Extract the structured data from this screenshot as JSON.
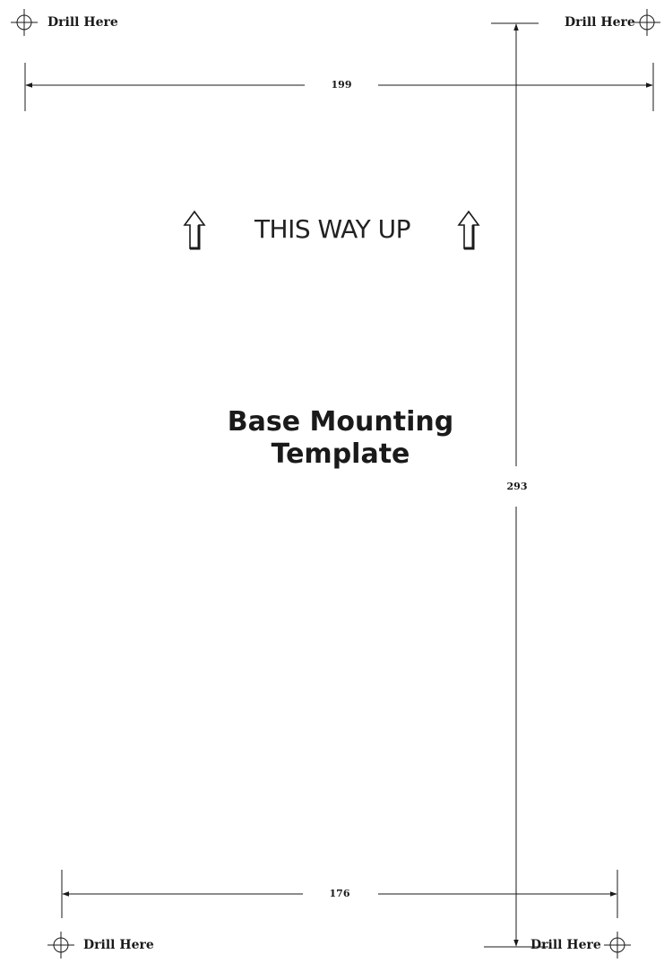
{
  "drill_markers": {
    "top_left": "Drill Here",
    "top_right": "Drill Here",
    "bottom_left": "Drill Here",
    "bottom_right": "Drill Here"
  },
  "dimensions": {
    "top_width": "199",
    "height": "293",
    "bottom_width": "176"
  },
  "orientation": {
    "text": "THIS WAY UP",
    "icon": "up-arrow-icon"
  },
  "title": {
    "line1": "Base Mounting",
    "line2": "Template"
  }
}
